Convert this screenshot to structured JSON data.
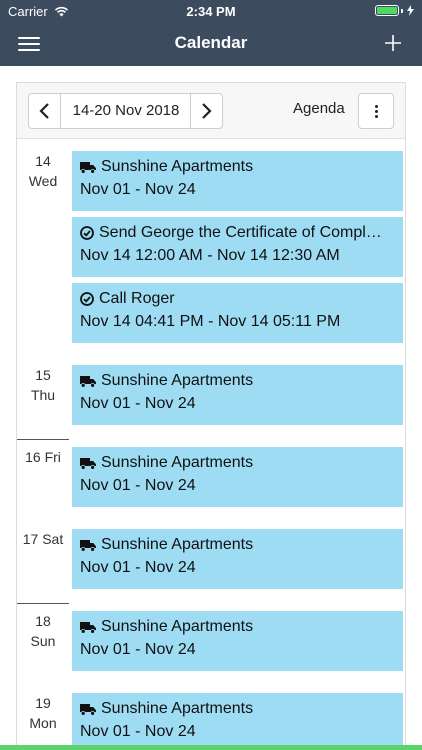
{
  "status_bar": {
    "carrier": "Carrier",
    "time": "2:34 PM",
    "wifi_icon": "wifi-icon",
    "battery_icon": "battery-icon"
  },
  "nav": {
    "title": "Calendar",
    "menu_icon": "hamburger-menu-icon",
    "add_icon": "plus-icon"
  },
  "toolbar": {
    "date_range": "14-20 Nov 2018",
    "view": "Agenda",
    "prev_icon": "chevron-left-icon",
    "next_icon": "chevron-right-icon",
    "more_icon": "vertical-ellipsis-icon"
  },
  "colors": {
    "header_bg": "#3d4b5f",
    "event_bg": "#9edcf4",
    "battery": "#4cd964"
  },
  "days": [
    {
      "day": "14",
      "weekday": "Wed",
      "events": [
        {
          "icon": "truck-icon",
          "title": "Sunshine Apartments",
          "time": "Nov 01 - Nov 24"
        },
        {
          "icon": "check-circle-icon",
          "title": "Send George the Certificate of Compl…",
          "time": "Nov 14 12:00 AM - Nov 14 12:30 AM"
        },
        {
          "icon": "check-circle-icon",
          "title": "Call Roger",
          "time": "Nov 14 04:41 PM - Nov 14 05:11 PM"
        }
      ]
    },
    {
      "day": "15",
      "weekday": "Thu",
      "events": [
        {
          "icon": "truck-icon",
          "title": "Sunshine Apartments",
          "time": "Nov 01 - Nov 24"
        }
      ]
    },
    {
      "day": "16",
      "weekday": "Fri",
      "events": [
        {
          "icon": "truck-icon",
          "title": "Sunshine Apartments",
          "time": "Nov 01 - Nov 24"
        }
      ]
    },
    {
      "day": "17",
      "weekday": "Sat",
      "events": [
        {
          "icon": "truck-icon",
          "title": "Sunshine Apartments",
          "time": "Nov 01 - Nov 24"
        }
      ]
    },
    {
      "day": "18",
      "weekday": "Sun",
      "events": [
        {
          "icon": "truck-icon",
          "title": "Sunshine Apartments",
          "time": "Nov 01 - Nov 24"
        }
      ]
    },
    {
      "day": "19",
      "weekday": "Mon",
      "events": [
        {
          "icon": "truck-icon",
          "title": "Sunshine Apartments",
          "time": "Nov 01 - Nov 24"
        }
      ]
    }
  ]
}
